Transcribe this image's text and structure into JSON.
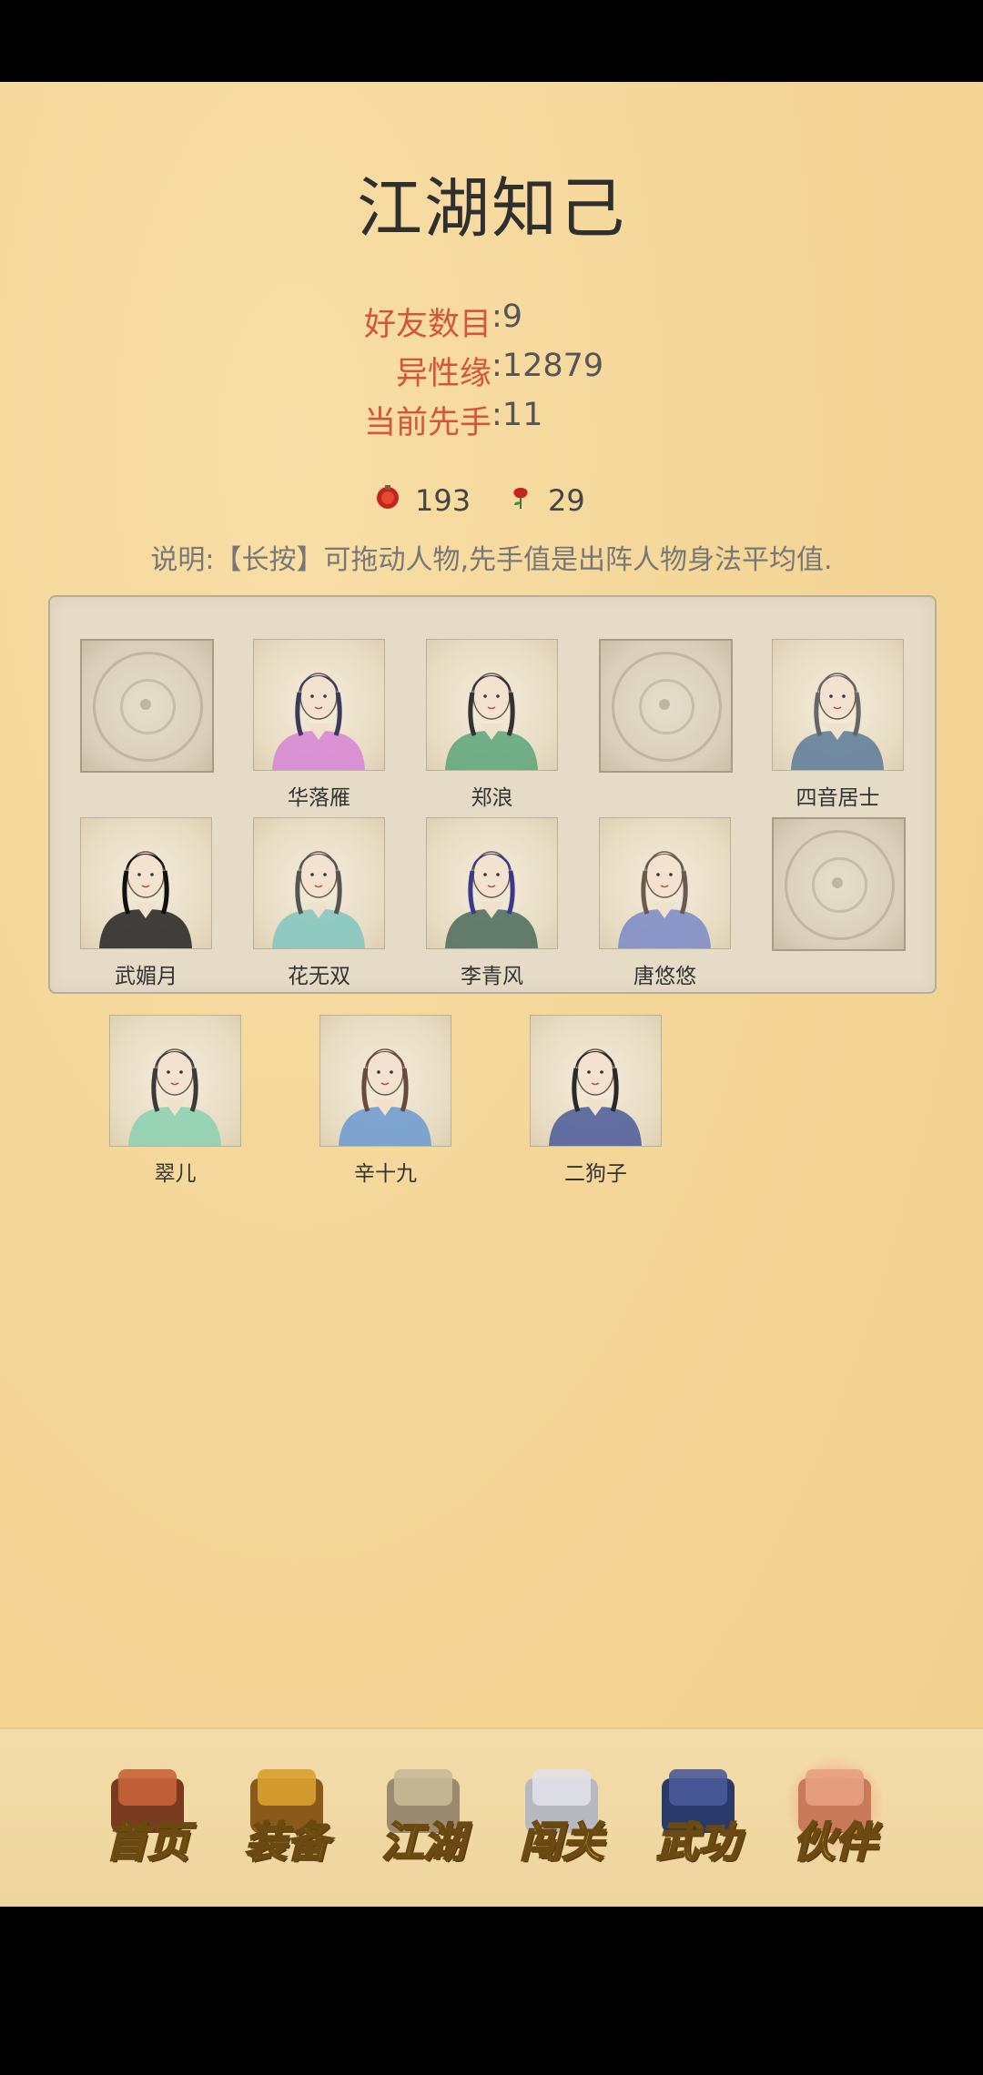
{
  "page": {
    "title": "江湖知己"
  },
  "stats": [
    {
      "label": "好友数目",
      "value": "9"
    },
    {
      "label": "异性缘",
      "value": "12879"
    },
    {
      "label": "当前先手",
      "value": "11"
    }
  ],
  "currency": [
    {
      "icon": "red-gourd-icon",
      "value": "193"
    },
    {
      "icon": "red-flower-icon",
      "value": "29"
    }
  ],
  "note": "说明:【长按】可拖动人物,先手值是出阵人物身法平均值.",
  "lineup": [
    {
      "name": "",
      "empty": true
    },
    {
      "name": "华落雁",
      "robe": "#d784d6",
      "hair": "#3a3a5a"
    },
    {
      "name": "郑浪",
      "robe": "#5aa57a",
      "hair": "#333"
    },
    {
      "name": "",
      "empty": true
    },
    {
      "name": "四音居士",
      "robe": "#5a7a9a",
      "hair": "#666"
    },
    {
      "name": "武媚月",
      "robe": "#222",
      "hair": "#111"
    },
    {
      "name": "花无双",
      "robe": "#7fc6c0",
      "hair": "#555"
    },
    {
      "name": "李青风",
      "robe": "#4a6a5a",
      "hair": "#3a3a8a"
    },
    {
      "name": "唐悠悠",
      "robe": "#7a8ac8",
      "hair": "#6a5a50"
    },
    {
      "name": "",
      "empty": true
    }
  ],
  "reserve": [
    {
      "name": "翠儿",
      "robe": "#8ad0b0",
      "hair": "#3a3a3a"
    },
    {
      "name": "辛十九",
      "robe": "#6a9ad0",
      "hair": "#6a4a40"
    },
    {
      "name": "二狗子",
      "robe": "#4a5a9a",
      "hair": "#2a2a2a"
    }
  ],
  "nav": [
    {
      "label": "首页",
      "icon": "house-icon"
    },
    {
      "label": "装备",
      "icon": "armor-icon"
    },
    {
      "label": "江湖",
      "icon": "scroll-map-icon"
    },
    {
      "label": "闯关",
      "icon": "crossed-swords-icon"
    },
    {
      "label": "武功",
      "icon": "book-icon"
    },
    {
      "label": "伙伴",
      "icon": "partners-icon",
      "active": true
    }
  ]
}
